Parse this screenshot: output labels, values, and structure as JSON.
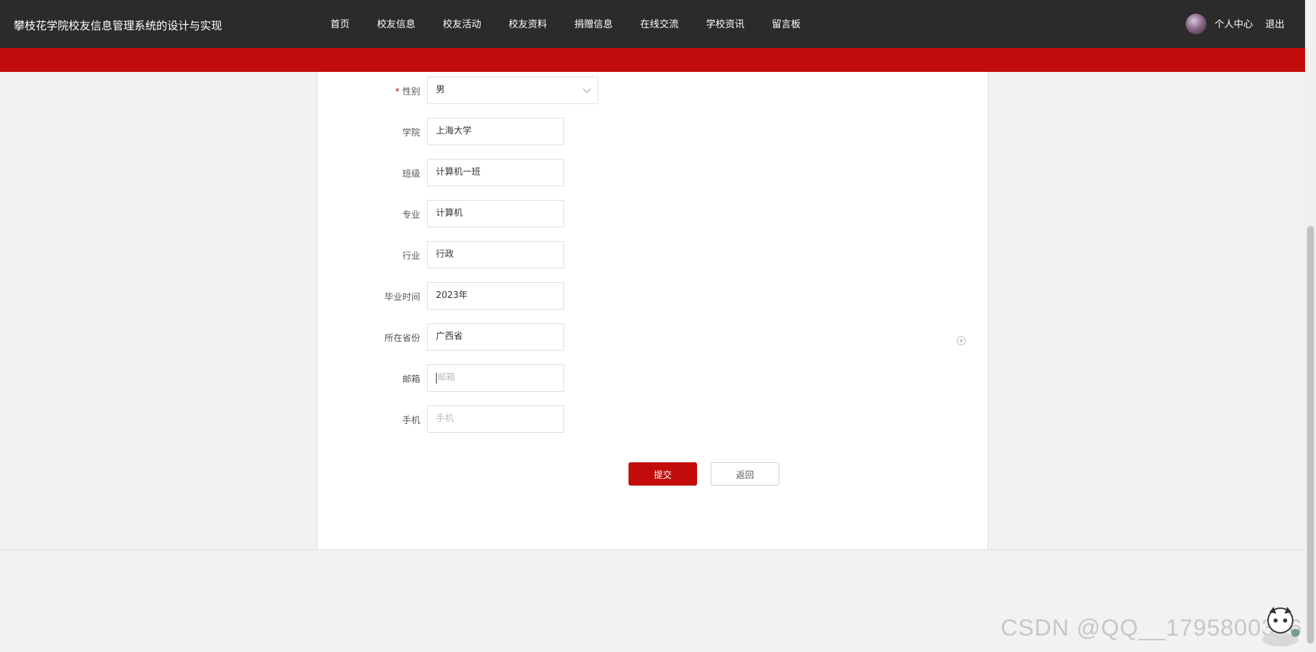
{
  "header": {
    "site_title": "攀枝花学院校友信息管理系统的设计与实现",
    "nav": [
      "首页",
      "校友信息",
      "校友活动",
      "校友资料",
      "捐赠信息",
      "在线交流",
      "学校资讯",
      "留言板"
    ],
    "user_center": "个人中心",
    "logout": "退出"
  },
  "form": {
    "gender": {
      "label": "性别",
      "required_mark": "*",
      "value": "男"
    },
    "college": {
      "label": "学院",
      "value": "上海大学"
    },
    "class": {
      "label": "班级",
      "value": "计算机一班"
    },
    "major": {
      "label": "专业",
      "value": "计算机"
    },
    "industry": {
      "label": "行业",
      "value": "行政"
    },
    "graduation_time": {
      "label": "毕业时间",
      "value": "2023年"
    },
    "province": {
      "label": "所在省份",
      "value": "广西省"
    },
    "email": {
      "label": "邮箱",
      "placeholder": "邮箱"
    },
    "phone": {
      "label": "手机",
      "placeholder": "手机"
    }
  },
  "buttons": {
    "submit": "提交",
    "back": "返回"
  },
  "watermark": "CSDN @QQ__1795800396",
  "colors": {
    "topbar": "#2b2b2b",
    "accent": "#c20c0c",
    "page_bg": "#f2f2f2"
  }
}
